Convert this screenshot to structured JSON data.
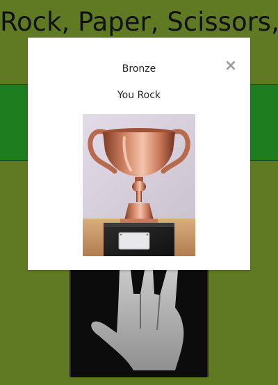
{
  "page": {
    "title": "Rock, Paper, Scissors,"
  },
  "modal": {
    "title": "Bronze",
    "close_icon": "×",
    "message": "You Rock",
    "image_icon": "bronze-trophy"
  },
  "choice": {
    "icon": "spock-hand"
  },
  "colors": {
    "background": "#5f7a22",
    "band": "#1e7d1e",
    "modal_bg": "#ffffff",
    "close": "#9a9a9a"
  }
}
